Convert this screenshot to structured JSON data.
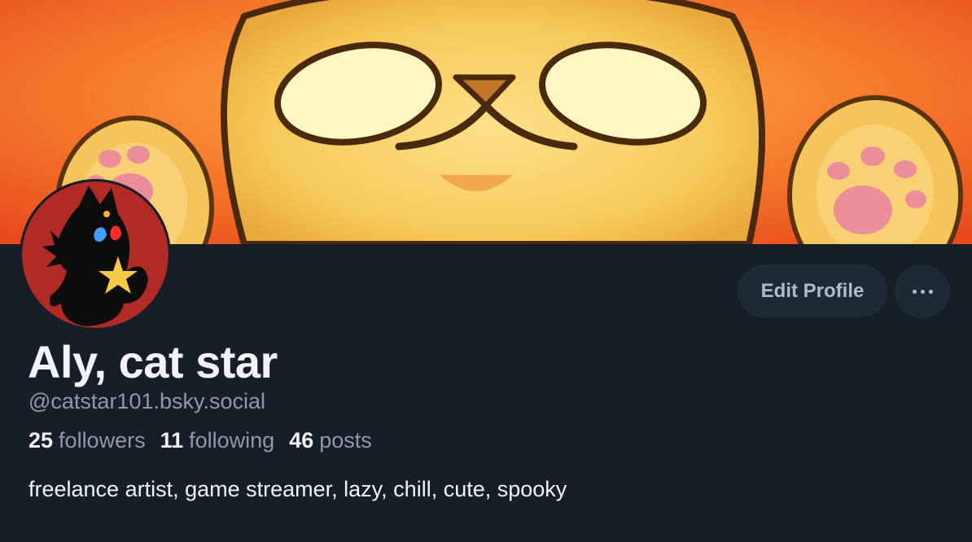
{
  "colors": {
    "background": "#161e27",
    "button_bg": "#1e2936",
    "text_primary": "#f1f3f5",
    "text_secondary": "#8c9aab",
    "banner_orange": "#f25a1e",
    "banner_cat": "#f3c35c",
    "avatar_red": "#b22a25"
  },
  "banner": {
    "icon": "cat-banner-image"
  },
  "avatar": {
    "icon": "cat-avatar-image"
  },
  "actions": {
    "edit_profile_label": "Edit Profile",
    "more_icon": "more-options-icon"
  },
  "profile": {
    "display_name": "Aly, cat star",
    "handle": "@catstar101.bsky.social",
    "bio": "freelance artist, game streamer, lazy, chill, cute, spooky"
  },
  "stats": {
    "followers": {
      "count": "25",
      "label": "followers"
    },
    "following": {
      "count": "11",
      "label": "following"
    },
    "posts": {
      "count": "46",
      "label": "posts"
    }
  }
}
